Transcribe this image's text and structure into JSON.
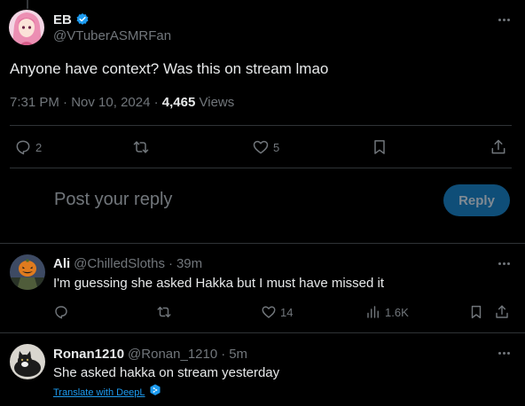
{
  "main_tweet": {
    "display_name": "EB",
    "handle": "@VTuberASMRFan",
    "text": "Anyone have context? Was this on stream lmao",
    "time": "7:31 PM",
    "date": "Nov 10, 2024",
    "views_count": "4,465",
    "views_label": "Views",
    "separator": "·",
    "actions": {
      "replies": "2",
      "likes": "5"
    }
  },
  "composer": {
    "placeholder": "Post your reply",
    "reply_button": "Reply"
  },
  "replies": [
    {
      "display_name": "Ali",
      "handle": "@ChilledSloths",
      "separator": "·",
      "time": "39m",
      "text": "I'm guessing she asked Hakka but I must have missed it",
      "likes": "14",
      "views": "1.6K"
    },
    {
      "display_name": "Ronan1210",
      "handle": "@Ronan_1210",
      "separator": "·",
      "time": "5m",
      "text": "She asked hakka on stream yesterday",
      "translate": "Translate with DeepL"
    }
  ],
  "colors": {
    "background": "#000000",
    "text": "#e7e9ea",
    "secondary": "#71767b",
    "accent": "#1d9bf0",
    "reply_button_bg": "#0f4e78",
    "divider": "#2f3336"
  },
  "icons": [
    "verified-badge-icon",
    "more-icon",
    "reply-icon",
    "repost-icon",
    "like-icon",
    "bookmark-icon",
    "share-icon",
    "views-icon",
    "deepl-icon"
  ]
}
